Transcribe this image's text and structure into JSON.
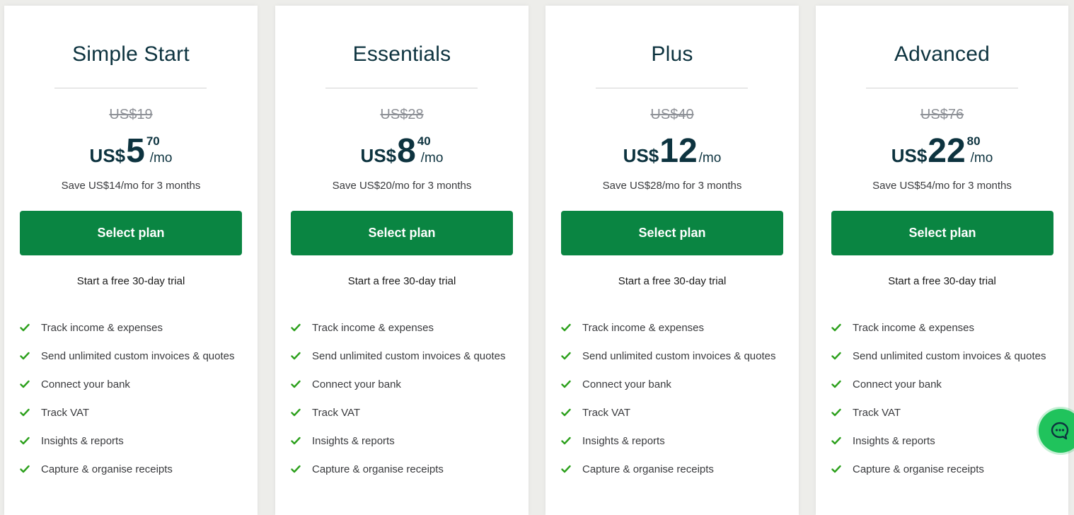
{
  "plans": [
    {
      "name": "Simple Start",
      "old_price": "US$19",
      "currency": "US$",
      "price_whole": "5",
      "price_cents": "70",
      "per": "/mo",
      "save_text": "Save US$14/mo for 3 months",
      "button_label": "Select plan",
      "trial_text": "Start a free 30-day trial",
      "features": [
        "Track income & expenses",
        "Send unlimited custom invoices & quotes",
        "Connect your bank",
        "Track VAT",
        "Insights & reports",
        "Capture & organise receipts"
      ]
    },
    {
      "name": "Essentials",
      "old_price": "US$28",
      "currency": "US$",
      "price_whole": "8",
      "price_cents": "40",
      "per": "/mo",
      "save_text": "Save US$20/mo for 3 months",
      "button_label": "Select plan",
      "trial_text": "Start a free 30-day trial",
      "features": [
        "Track income & expenses",
        "Send unlimited custom invoices & quotes",
        "Connect your bank",
        "Track VAT",
        "Insights & reports",
        "Capture & organise receipts"
      ]
    },
    {
      "name": "Plus",
      "old_price": "US$40",
      "currency": "US$",
      "price_whole": "12",
      "price_cents": "",
      "per": "/mo",
      "save_text": "Save US$28/mo for 3 months",
      "button_label": "Select plan",
      "trial_text": "Start a free 30-day trial",
      "features": [
        "Track income & expenses",
        "Send unlimited custom invoices & quotes",
        "Connect your bank",
        "Track VAT",
        "Insights & reports",
        "Capture & organise receipts"
      ]
    },
    {
      "name": "Advanced",
      "old_price": "US$76",
      "currency": "US$",
      "price_whole": "22",
      "price_cents": "80",
      "per": "/mo",
      "save_text": "Save US$54/mo for 3 months",
      "button_label": "Select plan",
      "trial_text": "Start a free 30-day trial",
      "features": [
        "Track income & expenses",
        "Send unlimited custom invoices & quotes",
        "Connect your bank",
        "Track VAT",
        "Insights & reports",
        "Capture & organise receipts"
      ]
    }
  ],
  "chat_widget": {
    "icon": "chat-bubble-icon"
  },
  "colors": {
    "primary_button": "#0a8542",
    "check": "#2ca01c",
    "heading": "#0d333f",
    "chat": "#20c35c"
  }
}
